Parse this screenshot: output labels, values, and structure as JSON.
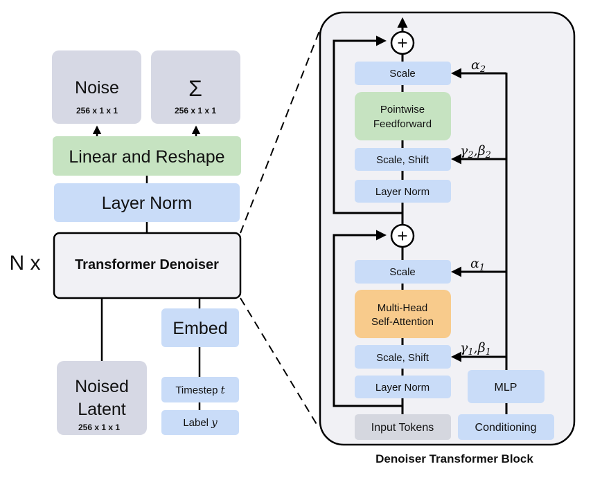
{
  "colors": {
    "gray_box": "#d6d8e4",
    "green_box": "#c6e3c1",
    "blue_box": "#c9dcf8",
    "orange_box": "#f8cb8c",
    "input_tokens_box": "#d5d7df",
    "denoiser_fill": "#f1f1f5",
    "block_fill": "#f1f1f5",
    "line": "#000000"
  },
  "left": {
    "outputs": [
      {
        "title": "Noise",
        "shape": "256 x 1  x 1"
      },
      {
        "title": "Σ",
        "shape": "256 x 1 x 1"
      }
    ],
    "linear_reshape": "Linear and Reshape",
    "layer_norm": "Layer Norm",
    "repeat_label": "N x",
    "transformer_denoiser": "Transformer Denoiser",
    "embed": "Embed",
    "noised_latent": {
      "line1": "Noised",
      "line2": "Latent",
      "shape": "256 x 1 x 1"
    },
    "timestep": {
      "label": "Timestep",
      "var": "t"
    },
    "class_label": {
      "label": "Label",
      "var": "y"
    }
  },
  "block": {
    "caption": "Denoiser Transformer Block",
    "upper": {
      "scale": "Scale",
      "ff_line1": "Pointwise",
      "ff_line2": "Feedforward",
      "scale_shift": "Scale, Shift",
      "layer_norm": "Layer Norm",
      "alpha": {
        "sym": "α",
        "sub": "2"
      },
      "gamma_beta": {
        "g": "γ",
        "gsub": "2",
        "sep": ",",
        "b": "β",
        "bsub": "2"
      }
    },
    "lower": {
      "scale": "Scale",
      "attn_line1": "Multi-Head",
      "attn_line2": "Self-Attention",
      "scale_shift": "Scale, Shift",
      "layer_norm": "Layer Norm",
      "alpha": {
        "sym": "α",
        "sub": "1"
      },
      "gamma_beta": {
        "g": "γ",
        "gsub": "1",
        "sep": ",",
        "b": "β",
        "bsub": "1"
      }
    },
    "plus_symbol": "+",
    "mlp": "MLP",
    "input_tokens": "Input Tokens",
    "conditioning": "Conditioning"
  }
}
